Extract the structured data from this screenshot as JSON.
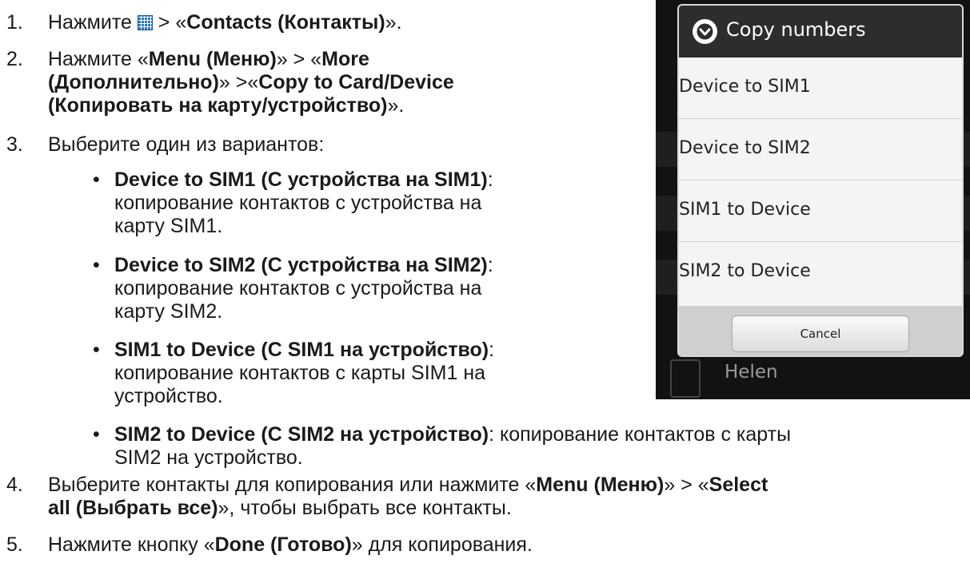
{
  "instructions": {
    "s1": {
      "num": "1.",
      "a": "Нажмите ",
      "b": " > «",
      "c": "Contacts (Контакты)",
      "d": "»."
    },
    "s2": {
      "num": "2.",
      "a": "Нажмите «",
      "b": "Menu (Меню)",
      "c": "» > «",
      "d": "More",
      "e": "(Дополнительно)",
      "f": "» >«",
      "g": "Copy to Card/Device",
      "h": "(Копировать на карту/устройство)",
      "i": "»."
    },
    "s3": {
      "num": "3.",
      "text": "Выберите один из вариантов:"
    },
    "bullets": [
      {
        "dot": "•",
        "bold": "Device to SIM1 (С устройства на SIM1)",
        "rest": ":",
        "l2": "копирование контактов с устройства на",
        "l3": "карту SIM1."
      },
      {
        "dot": "•",
        "bold": "Device to SIM2 (С устройства на SIM2)",
        "rest": ":",
        "l2": "копирование контактов с устройства на",
        "l3": "карту SIM2."
      },
      {
        "dot": "•",
        "bold": "SIM1 to Device (С SIM1 на устройство)",
        "rest": ":",
        "l2": "копирование контактов с карты SIM1 на",
        "l3": "устройство."
      },
      {
        "dot": "•",
        "bold": "SIM2 to Device (С SIM2 на устройство)",
        "rest": ": копирование контактов с карты",
        "l2": "SIM2 на устройство."
      }
    ],
    "s4": {
      "num": "4.",
      "a": "Выберите контакты для копирования или нажмите «",
      "b": "Menu (Меню)",
      "c": "» > «",
      "d": "Select",
      "e": "all (Выбрать все)",
      "f": "», чтобы выбрать все контакты."
    },
    "s5": {
      "num": "5.",
      "a": "Нажмите кнопку «",
      "b": "Done (Готово)",
      "c": "» для копирования."
    }
  },
  "dialog": {
    "title": "Copy numbers",
    "title_icon": "chevron-down-circle-icon",
    "options": [
      "Device to SIM1",
      "Device to SIM2",
      "SIM1 to Device",
      "SIM2 to Device"
    ],
    "cancel_label": "Cancel"
  },
  "background_contact": {
    "name": "Helen"
  },
  "colors": {
    "dialog_title_bg": "#2d2d2d",
    "dialog_bg": "#f4f4f4",
    "phone_bg": "#121212"
  }
}
